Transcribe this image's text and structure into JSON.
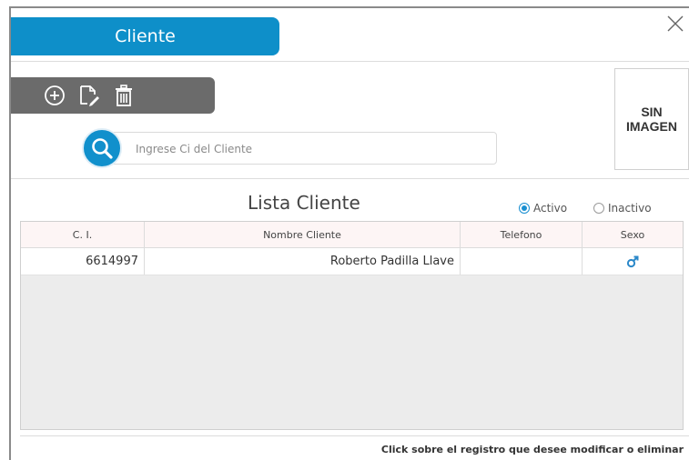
{
  "window": {
    "title": "Cliente"
  },
  "toolbar": {
    "add_icon": "add-circle-icon",
    "edit_icon": "edit-document-icon",
    "delete_icon": "trash-icon"
  },
  "search": {
    "placeholder": "Ingrese Ci del Cliente",
    "value": ""
  },
  "photo": {
    "label": "SIN\nIMAGEN"
  },
  "list": {
    "title": "Lista Cliente",
    "filter": {
      "options": [
        {
          "label": "Activo",
          "selected": true
        },
        {
          "label": "Inactivo",
          "selected": false
        }
      ]
    },
    "columns": [
      "C. I.",
      "Nombre Cliente",
      "Telefono",
      "Sexo"
    ],
    "rows": [
      {
        "ci": "6614997",
        "nombre": "Roberto Padilla Llave",
        "telefono": "",
        "sexo_icon": "male-icon"
      }
    ]
  },
  "footer": {
    "hint": "Click  sobre el registro que desee modificar o eliminar"
  },
  "colors": {
    "accent": "#0e8fc9",
    "toolbar_bg": "#6b6b6b"
  }
}
